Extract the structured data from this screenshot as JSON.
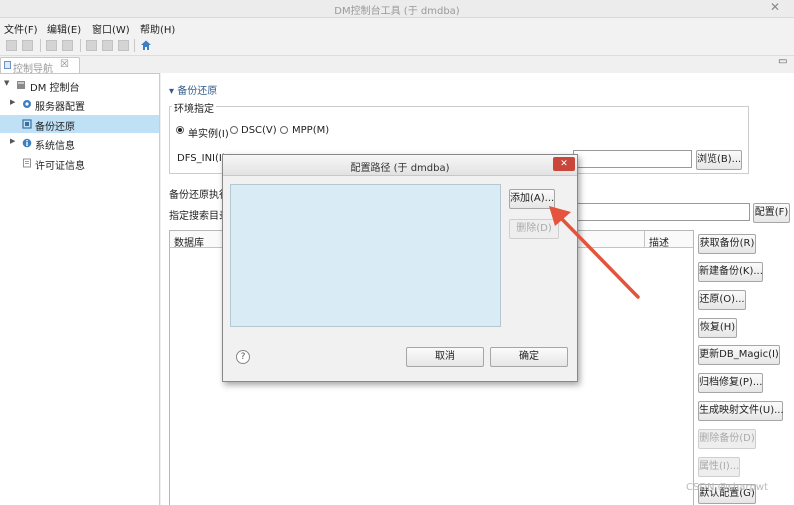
{
  "window": {
    "title": "DM控制台工具 (于 dmdba)",
    "close_glyph": "✕"
  },
  "menu": [
    "文件(F)",
    "编辑(E)",
    "窗口(W)",
    "帮助(H)"
  ],
  "nav_tab": {
    "label": "控制导航",
    "close": "☒"
  },
  "tree": [
    {
      "label": "DM 控制台",
      "expanded": true
    },
    {
      "label": "服务器配置",
      "expanded": false
    },
    {
      "label": "备份还原",
      "selected": true
    },
    {
      "label": "系统信息",
      "expanded": false
    },
    {
      "label": "许可证信息"
    }
  ],
  "main": {
    "section_title": "备份还原",
    "env_group": "环境指定",
    "radios": [
      {
        "label": "单实例(I)",
        "checked": true
      },
      {
        "label": "DSC(V)",
        "checked": false
      },
      {
        "label": "MPP(M)",
        "checked": false
      }
    ],
    "dfs_label": "DFS_INI(I)",
    "browse_button": "浏览(B)...",
    "backup_path_label": "备份还原执行",
    "search_dir_label": "指定搜索目录",
    "config_button": "配置(F)",
    "table_headers": [
      "数据库",
      "描述"
    ],
    "side_buttons": [
      {
        "label": "获取备份(R)",
        "enabled": true
      },
      {
        "label": "新建备份(K)...",
        "enabled": true
      },
      {
        "label": "还原(O)...",
        "enabled": true
      },
      {
        "label": "恢复(H)",
        "enabled": true
      },
      {
        "label": "更新DB_Magic(I)",
        "enabled": true
      },
      {
        "label": "归档修复(P)...",
        "enabled": true
      },
      {
        "label": "生成映射文件(U)...",
        "enabled": true
      },
      {
        "label": "删除备份(D)",
        "enabled": false
      },
      {
        "label": "属性(I)...",
        "enabled": false
      },
      {
        "label": "默认配置(G)",
        "enabled": true
      }
    ]
  },
  "dialog": {
    "title": "配置路径 (于 dmdba)",
    "add_button": "添加(A)...",
    "delete_button": "删除(D)",
    "cancel_button": "取消",
    "ok_button": "确定",
    "help_glyph": "?"
  },
  "watermark": "CSDN @sharpwt",
  "colors": {
    "accent": "#3b7fc4",
    "selection": "#bfe0f5",
    "list_bg": "#d9ebf4",
    "annotation_arrow": "#e4533b"
  }
}
